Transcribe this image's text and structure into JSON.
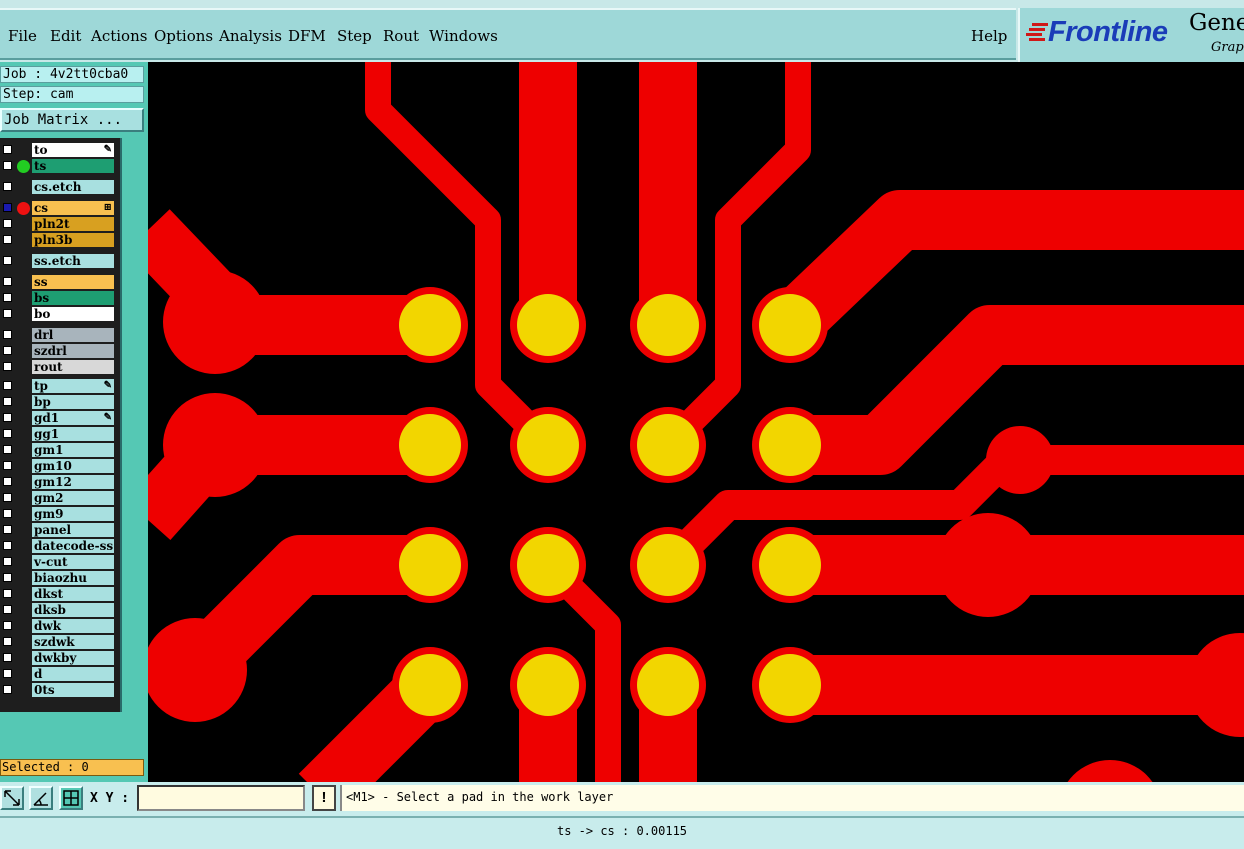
{
  "menu": {
    "file": "File",
    "edit": "Edit",
    "actions": "Actions",
    "options": "Options",
    "analysis": "Analysis",
    "dfm": "DFM",
    "step": "Step",
    "rout": "Rout",
    "windows": "Windows",
    "help": "Help"
  },
  "brand": {
    "logo": "Frontline",
    "product": "Gene",
    "subtitle": "Graph"
  },
  "job": {
    "job_line": "Job : 4v2tt0cba0",
    "step_line": "Step: cam",
    "matrix_button": "Job Matrix ..."
  },
  "layers": [
    {
      "name": "to",
      "bg": "#ffffff",
      "mark": "✎"
    },
    {
      "name": "ts",
      "bg": "#1e9e72",
      "dot": "#22cc22",
      "mark": ""
    },
    {
      "name": "cs.etch",
      "bg": "#a8e0e0",
      "mark": ""
    },
    {
      "name": "cs",
      "bg": "#f8c050",
      "dot": "#ee1111",
      "checked": true,
      "mark": "⊞"
    },
    {
      "name": "pln2t",
      "bg": "#d8a020",
      "mark": ""
    },
    {
      "name": "pln3b",
      "bg": "#d8a020",
      "mark": ""
    },
    {
      "name": "ss.etch",
      "bg": "#a8e0e0",
      "mark": ""
    },
    {
      "name": "ss",
      "bg": "#f8c050",
      "mark": ""
    },
    {
      "name": "bs",
      "bg": "#1e9e72",
      "mark": ""
    },
    {
      "name": "bo",
      "bg": "#ffffff",
      "mark": ""
    },
    {
      "name": "drl",
      "bg": "#a8b4bc",
      "mark": ""
    },
    {
      "name": "szdrl",
      "bg": "#a8b4bc",
      "mark": ""
    },
    {
      "name": "rout",
      "bg": "#d8d8d8",
      "mark": ""
    },
    {
      "name": "tp",
      "bg": "#a8e0e0",
      "mark": "✎"
    },
    {
      "name": "bp",
      "bg": "#a8e0e0",
      "mark": ""
    },
    {
      "name": "gd1",
      "bg": "#a8e0e0",
      "mark": "✎"
    },
    {
      "name": "gg1",
      "bg": "#a8e0e0",
      "mark": ""
    },
    {
      "name": "gm1",
      "bg": "#a8e0e0",
      "mark": ""
    },
    {
      "name": "gm10",
      "bg": "#a8e0e0",
      "mark": ""
    },
    {
      "name": "gm12",
      "bg": "#a8e0e0",
      "mark": ""
    },
    {
      "name": "gm2",
      "bg": "#a8e0e0",
      "mark": ""
    },
    {
      "name": "gm9",
      "bg": "#a8e0e0",
      "mark": ""
    },
    {
      "name": "panel",
      "bg": "#a8e0e0",
      "mark": ""
    },
    {
      "name": "datecode-ss",
      "bg": "#a8e0e0",
      "mark": ""
    },
    {
      "name": "v-cut",
      "bg": "#a8e0e0",
      "mark": ""
    },
    {
      "name": "biaozhu",
      "bg": "#a8e0e0",
      "mark": ""
    },
    {
      "name": "dkst",
      "bg": "#a8e0e0",
      "mark": ""
    },
    {
      "name": "dksb",
      "bg": "#a8e0e0",
      "mark": ""
    },
    {
      "name": "dwk",
      "bg": "#a8e0e0",
      "mark": ""
    },
    {
      "name": "szdwk",
      "bg": "#a8e0e0",
      "mark": ""
    },
    {
      "name": "dwkby",
      "bg": "#a8e0e0",
      "mark": ""
    },
    {
      "name": "d",
      "bg": "#a8e0e0",
      "mark": ""
    },
    {
      "name": "0ts",
      "bg": "#a8e0e0",
      "mark": ""
    }
  ],
  "selected": "Selected : 0",
  "toolbar": {
    "xy_label": "X Y :",
    "xy_value": "",
    "alert_glyph": "!",
    "prompt": "<M1> - Select a pad in the work layer"
  },
  "status": "ts -> cs : 0.00115",
  "colors": {
    "trace": "#ee0000",
    "pad": "#f2d600",
    "canvas": "#000000",
    "panel": "#55c8b4",
    "menu_bg": "#9ed8d8"
  },
  "icons": {
    "measure": "arrow-diagonal-icon",
    "measure_alt": "angle-measure-icon",
    "grid": "grid-icon",
    "logo_mark": "stripes-logo-icon"
  }
}
